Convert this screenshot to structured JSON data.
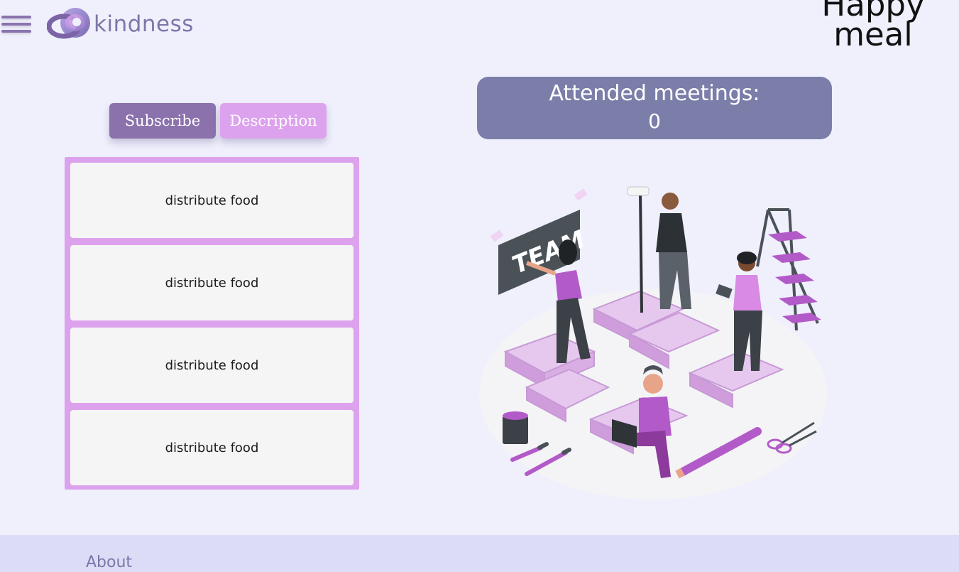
{
  "header": {
    "brand": "kindness",
    "title": "Happy meal"
  },
  "tabs": [
    {
      "label": "Subscribe"
    },
    {
      "label": "Description"
    }
  ],
  "tasks": [
    {
      "label": "distribute food"
    },
    {
      "label": "distribute food"
    },
    {
      "label": "distribute food"
    },
    {
      "label": "distribute food"
    }
  ],
  "meetings": {
    "label": "Attended meetings:",
    "count": "0"
  },
  "illustration": {
    "sign_text": "TEAM",
    "icon": "team-puzzle-illustration"
  },
  "footer": {
    "about": "About"
  },
  "colors": {
    "background": "#eff0fc",
    "accent_dark": "#8c72ad",
    "accent_light": "#dda2ee",
    "meetings_bg": "#7b7ea8",
    "footer_bg": "#dcdcf7",
    "brand_text": "#7b77a8"
  }
}
